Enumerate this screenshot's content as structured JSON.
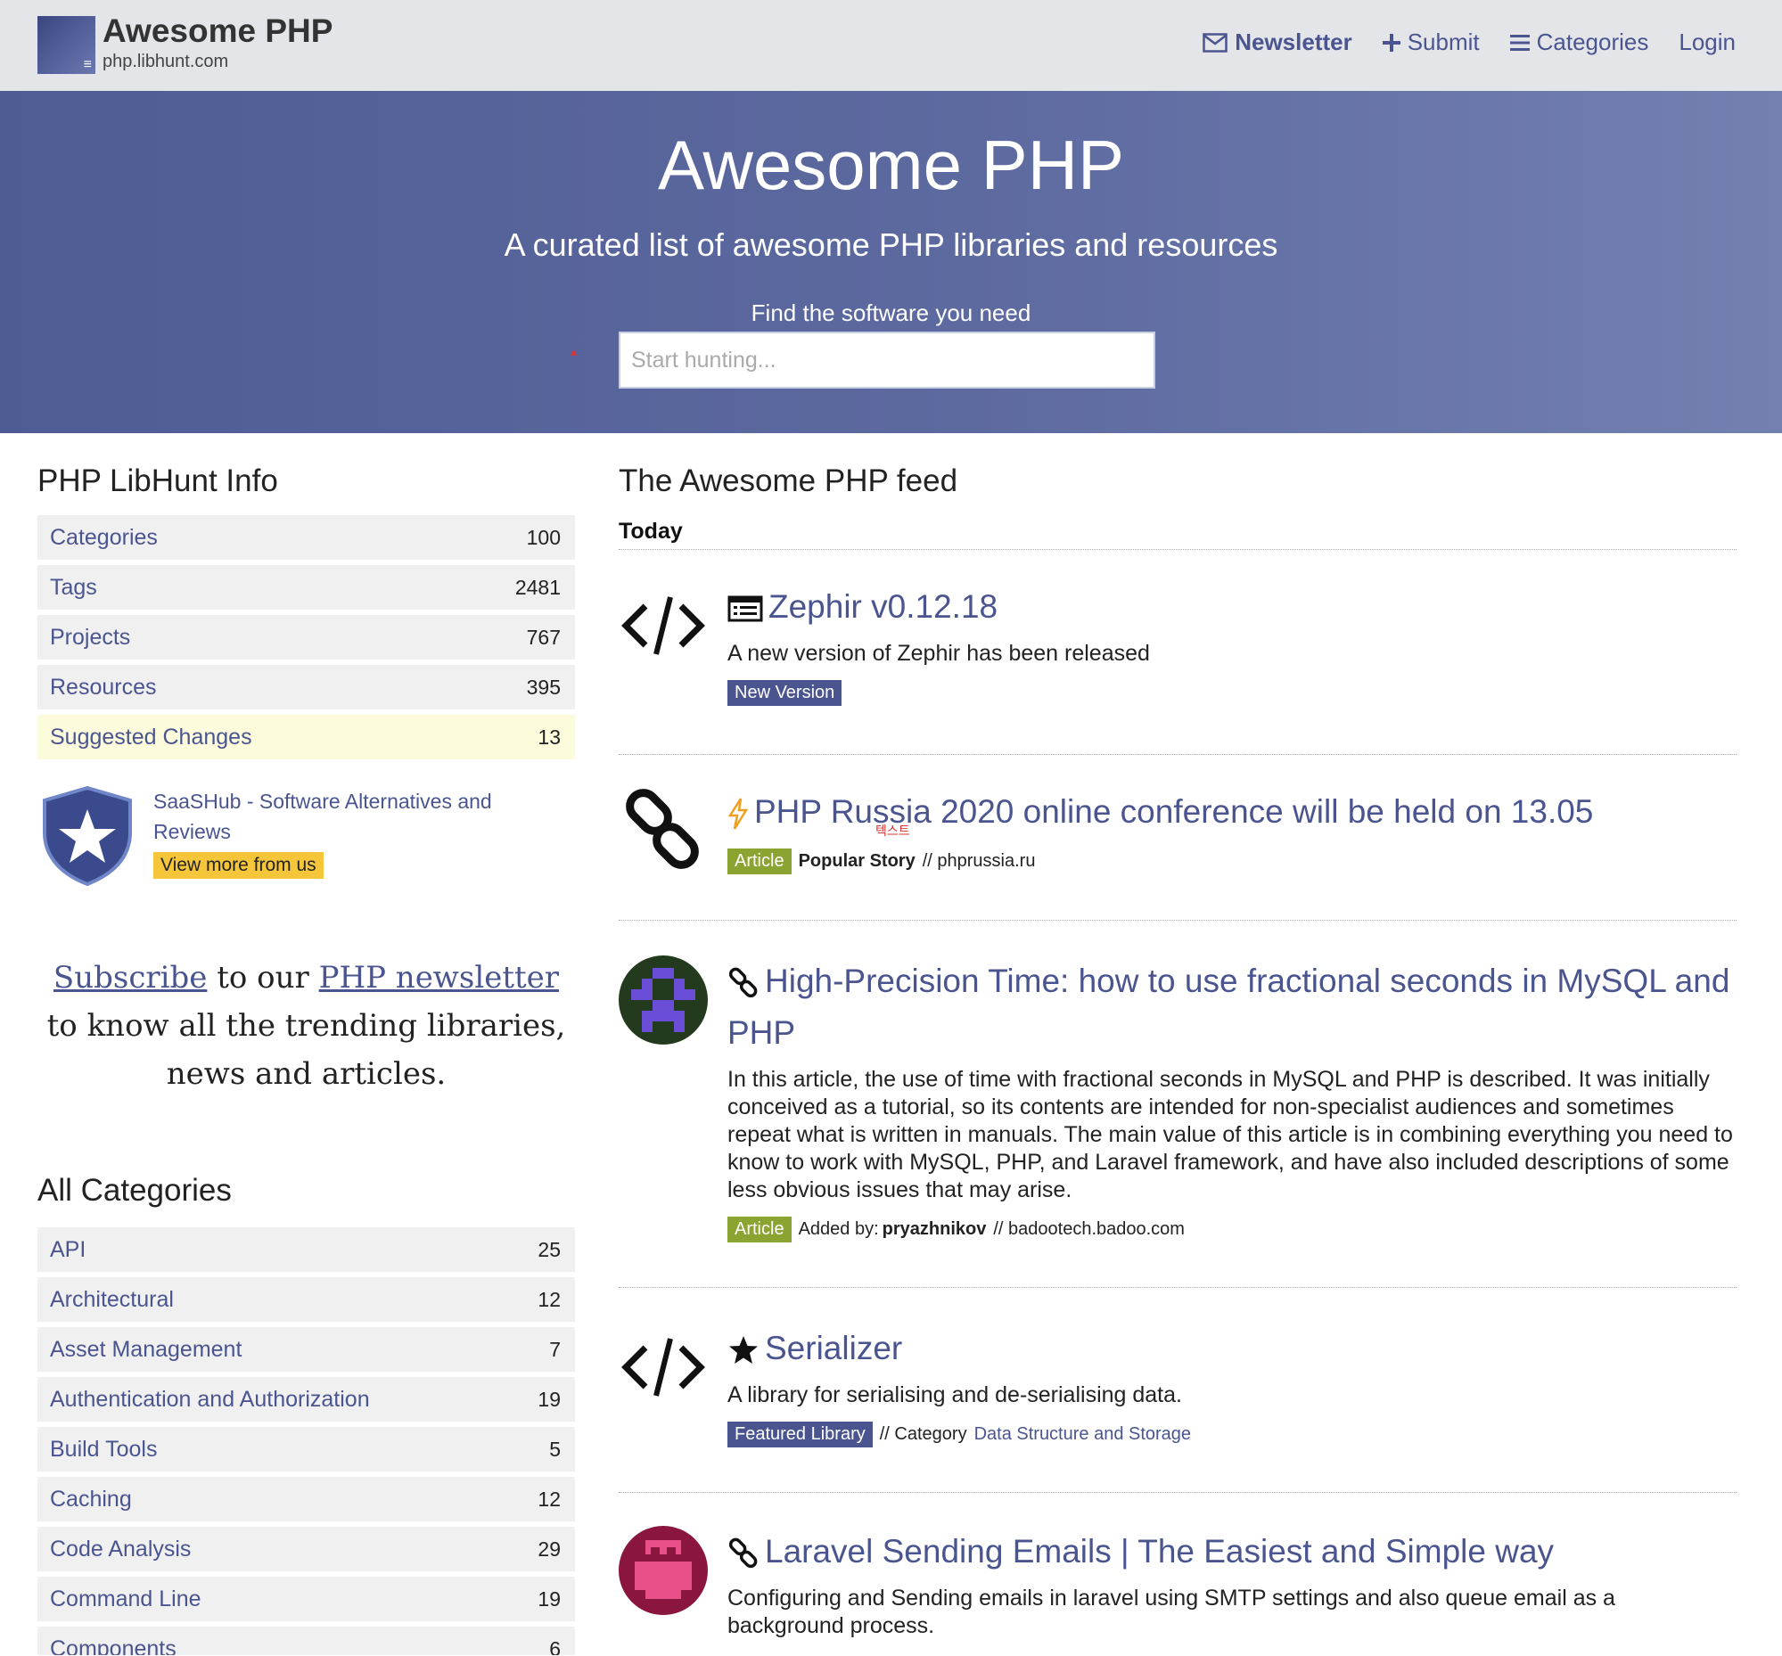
{
  "brand": {
    "title": "Awesome PHP",
    "subtitle": "php.libhunt.com"
  },
  "nav": {
    "newsletter": "Newsletter",
    "submit": "Submit",
    "categories": "Categories",
    "login": "Login"
  },
  "hero": {
    "title": "Awesome PHP",
    "tagline": "A curated list of awesome PHP libraries and resources",
    "find_label": "Find the software you need",
    "search_placeholder": "Start hunting..."
  },
  "info": {
    "heading": "PHP LibHunt Info",
    "rows": [
      {
        "label": "Categories",
        "count": "100"
      },
      {
        "label": "Tags",
        "count": "2481"
      },
      {
        "label": "Projects",
        "count": "767"
      },
      {
        "label": "Resources",
        "count": "395"
      },
      {
        "label": "Suggested Changes",
        "count": "13"
      }
    ]
  },
  "saashub": {
    "text": "SaaSHub - Software Alternatives and Reviews",
    "button": "View more from us"
  },
  "subscribe": {
    "link1": "Subscribe",
    "mid1": " to our ",
    "link2": "PHP newsletter",
    "rest": "to know all the trending libraries, news and articles."
  },
  "categories": {
    "heading": "All Categories",
    "rows": [
      {
        "label": "API",
        "count": "25"
      },
      {
        "label": "Architectural",
        "count": "12"
      },
      {
        "label": "Asset Management",
        "count": "7"
      },
      {
        "label": "Authentication and Authorization",
        "count": "19"
      },
      {
        "label": "Build Tools",
        "count": "5"
      },
      {
        "label": "Caching",
        "count": "12"
      },
      {
        "label": "Code Analysis",
        "count": "29"
      },
      {
        "label": "Command Line",
        "count": "19"
      },
      {
        "label": "Components",
        "count": "6"
      }
    ]
  },
  "feed": {
    "heading": "The Awesome PHP feed",
    "day": "Today",
    "items": [
      {
        "title": "Zephir v0.12.18",
        "desc": "A new version of Zephir has been released",
        "badge": "New Version"
      },
      {
        "title": "PHP Russia 2020 online conference will be held on 13.05",
        "badge": "Article",
        "bold": "Popular Story",
        "source": "// phprussia.ru"
      },
      {
        "title": "High-Precision Time: how to use fractional seconds in MySQL and PHP",
        "desc": "In this article, the use of time with fractional seconds in MySQL and PHP is described. It was initially conceived as a tutorial, so its contents are intended for non-specialist audiences and sometimes repeat what is written in manuals. The main value of this article is in combining everything you need to know to work with MySQL, PHP, and Laravel framework, and have also included descriptions of some less obvious issues that may arise.",
        "badge": "Article",
        "added_by": "Added by:",
        "author": "pryazhnikov",
        "source": "// badootech.badoo.com"
      },
      {
        "title": "Serializer",
        "desc": "A library for serialising and de-serialising data.",
        "badge": "Featured Library",
        "cat_prefix": "// Category",
        "category": "Data Structure and Storage"
      },
      {
        "title": "Laravel Sending Emails | The Easiest and Simple way",
        "desc": "Configuring and Sending emails in laravel using SMTP settings and also queue email as a background process."
      }
    ]
  },
  "overlay_text": "텍스트",
  "colors": {
    "accent": "#4a5590",
    "article_badge": "#8ba330",
    "saashub_button": "#f6c63a",
    "highlight_row": "#fcfbdc"
  }
}
